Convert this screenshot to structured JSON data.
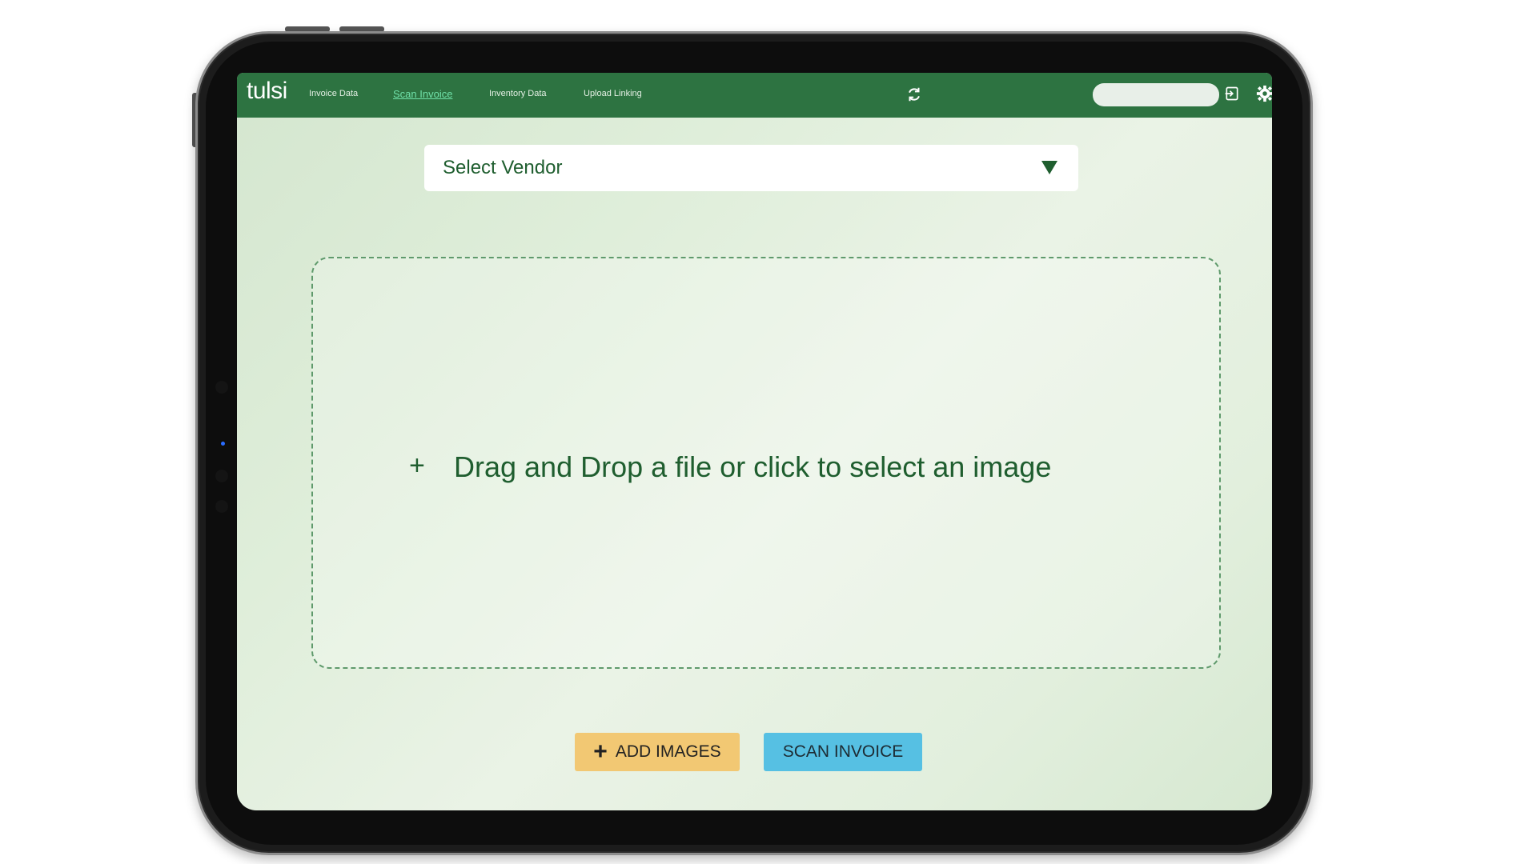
{
  "app": {
    "logo_text": "tulsi"
  },
  "nav": {
    "items": [
      {
        "label": "Invoice Data"
      },
      {
        "label": "Scan Invoice"
      },
      {
        "label": "Inventory Data"
      },
      {
        "label": "Upload Linking"
      }
    ],
    "active": "Scan Invoice"
  },
  "header": {
    "search_value": "",
    "icons": [
      "refresh-icon",
      "logout-icon",
      "gear-icon"
    ]
  },
  "vendor_select": {
    "label": "Select Vendor"
  },
  "dropzone": {
    "plus": "+",
    "text": "Drag and Drop a file or click to select an image"
  },
  "actions": {
    "add_images_label": "ADD IMAGES",
    "scan_invoice_label": "SCAN INVOICE"
  },
  "colors": {
    "topbar": "#2d7341",
    "accent_text": "#1f5e2f",
    "add_button": "#f2c873",
    "scan_button": "#56c0e3"
  }
}
